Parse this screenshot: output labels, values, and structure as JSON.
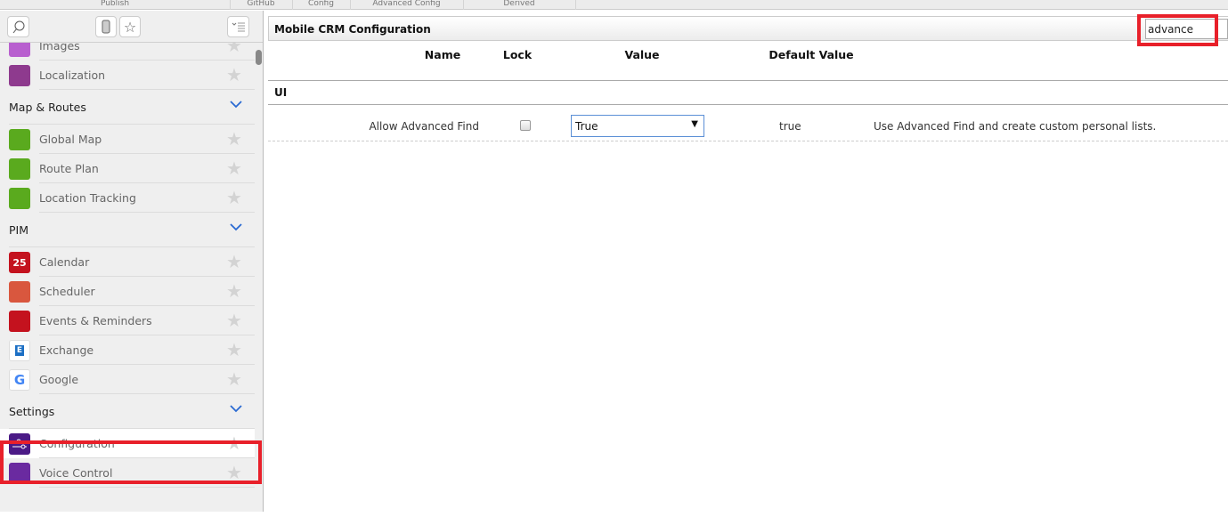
{
  "top_tabs": [
    "Publish",
    "GitHub",
    "Config",
    "Advanced Config",
    "Derived"
  ],
  "sidebar": {
    "entries": [
      {
        "type": "item",
        "label": "",
        "icon": "partial-icon",
        "color": "#b85fcf"
      },
      {
        "type": "item",
        "label": "Images",
        "icon": "image-icon",
        "color": "#b85fcf"
      },
      {
        "type": "item",
        "label": "Localization",
        "icon": "translate-icon",
        "color": "#8e3a8e"
      },
      {
        "type": "header",
        "label": "Map & Routes"
      },
      {
        "type": "item",
        "label": "Global Map",
        "icon": "map-icon",
        "color": "#5aaa1e"
      },
      {
        "type": "item",
        "label": "Route Plan",
        "icon": "route-icon",
        "color": "#5aaa1e"
      },
      {
        "type": "item",
        "label": "Location Tracking",
        "icon": "location-pin-icon",
        "color": "#5aaa1e"
      },
      {
        "type": "header",
        "label": "PIM"
      },
      {
        "type": "item",
        "label": "Calendar",
        "icon": "calendar-icon",
        "color": "#c4121e",
        "glyph": "25"
      },
      {
        "type": "item",
        "label": "Scheduler",
        "icon": "scheduler-icon",
        "color": "#d9573e"
      },
      {
        "type": "item",
        "label": "Events & Reminders",
        "icon": "bell-icon",
        "color": "#c4121e"
      },
      {
        "type": "item",
        "label": "Exchange",
        "icon": "exchange-icon",
        "color": "#ffffff"
      },
      {
        "type": "item",
        "label": "Google",
        "icon": "google-icon",
        "color": "#ffffff"
      },
      {
        "type": "header",
        "label": "Settings"
      },
      {
        "type": "item",
        "label": "Configuration",
        "icon": "sliders-icon",
        "color": "#4b1a86",
        "selected": true
      },
      {
        "type": "item",
        "label": "Voice Control",
        "icon": "microphone-icon",
        "color": "#6a2aa0"
      }
    ]
  },
  "panel": {
    "title": "Mobile CRM Configuration",
    "search_value": "advance",
    "columns": {
      "name": "Name",
      "lock": "Lock",
      "value": "Value",
      "default": "Default Value"
    },
    "section": "UI",
    "rows": [
      {
        "name": "Allow Advanced Find",
        "locked": false,
        "value": "True",
        "default": "true",
        "description": "Use Advanced Find and create custom personal lists."
      }
    ]
  },
  "colors": {
    "highlight": "#e8202a",
    "chevron": "#2a6ad2"
  }
}
